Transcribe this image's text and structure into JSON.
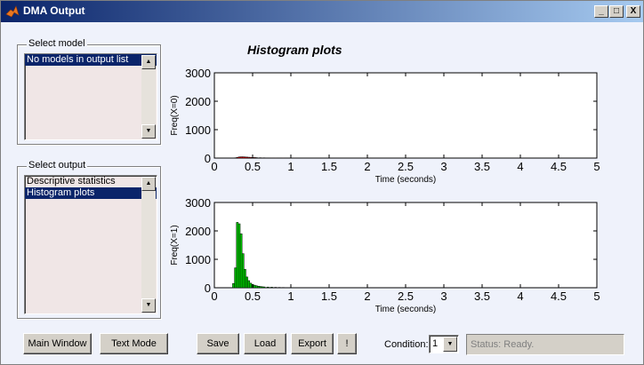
{
  "window": {
    "title": "DMA Output",
    "min": "_",
    "max": "□",
    "close": "X"
  },
  "select_model": {
    "legend": "Select model",
    "items": [
      "No models in output list"
    ],
    "selected": 0
  },
  "select_output": {
    "legend": "Select output",
    "items": [
      "Descriptive statistics",
      "Histogram plots"
    ],
    "selected": 1
  },
  "plot_title": "Histogram plots",
  "colors": {
    "series_x0": "#ff0000",
    "series_x1": "#00cc00"
  },
  "chart_data": [
    {
      "type": "bar",
      "ylabel": "Freq(X=0)",
      "xlabel": "Time (seconds)",
      "xlim": [
        0,
        5
      ],
      "ylim": [
        0,
        3000
      ],
      "xticks": [
        "0",
        "0.5",
        "1",
        "1.5",
        "2",
        "2.5",
        "3",
        "3.5",
        "4",
        "4.5",
        "5"
      ],
      "yticks": [
        "0",
        "1000",
        "2000",
        "3000"
      ],
      "bin_width": 0.025,
      "x": [
        0.275,
        0.3,
        0.325,
        0.35,
        0.375,
        0.4,
        0.425,
        0.45,
        0.475,
        0.5,
        0.525,
        0.55,
        0.6,
        0.65,
        0.7,
        0.75,
        0.8,
        0.9,
        1.05
      ],
      "values": [
        10,
        25,
        40,
        45,
        45,
        40,
        35,
        30,
        25,
        20,
        20,
        15,
        12,
        10,
        8,
        6,
        5,
        4,
        3
      ],
      "color": "#ff0000"
    },
    {
      "type": "bar",
      "ylabel": "Freq(X=1)",
      "xlabel": "Time (seconds)",
      "xlim": [
        0,
        5
      ],
      "ylim": [
        0,
        3000
      ],
      "xticks": [
        "0",
        "0.5",
        "1",
        "1.5",
        "2",
        "2.5",
        "3",
        "3.5",
        "4",
        "4.5",
        "5"
      ],
      "yticks": [
        "0",
        "1000",
        "2000",
        "3000"
      ],
      "bin_width": 0.025,
      "x": [
        0.25,
        0.275,
        0.3,
        0.325,
        0.35,
        0.375,
        0.4,
        0.425,
        0.45,
        0.475,
        0.5,
        0.525,
        0.55,
        0.575,
        0.6,
        0.625,
        0.65,
        0.7,
        0.75,
        0.8,
        0.85,
        0.9,
        1.0,
        1.05
      ],
      "values": [
        150,
        700,
        2300,
        2250,
        1900,
        1200,
        650,
        380,
        250,
        160,
        120,
        90,
        70,
        55,
        45,
        35,
        30,
        25,
        20,
        15,
        12,
        10,
        8,
        6
      ],
      "color": "#00cc00"
    }
  ],
  "buttons": {
    "main_window": "Main Window",
    "text_mode": "Text Mode",
    "save": "Save",
    "load": "Load",
    "export": "Export",
    "bang": "!"
  },
  "condition": {
    "label": "Condition:",
    "value": "1"
  },
  "status": "Status: Ready."
}
